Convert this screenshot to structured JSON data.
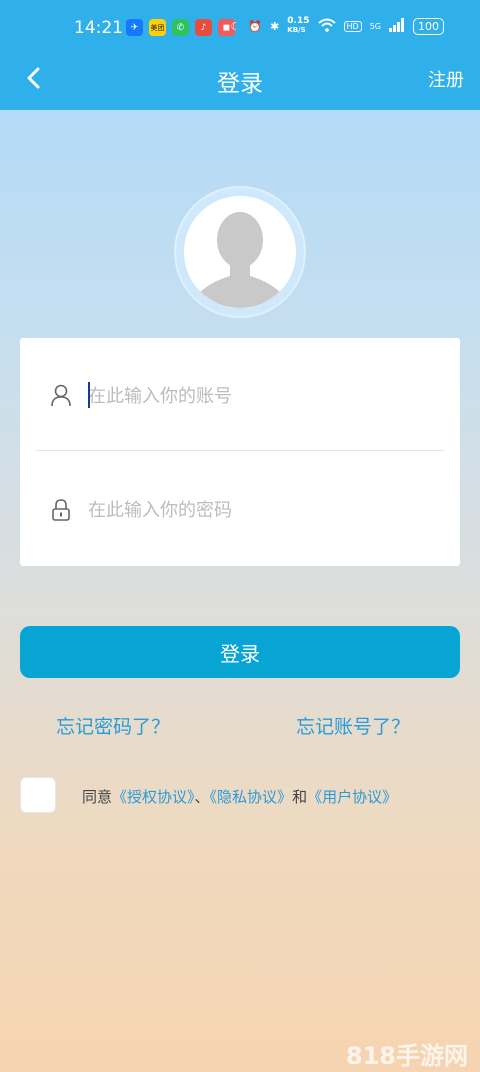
{
  "status": {
    "time": "14:21",
    "speed_value": "0.15",
    "speed_unit": "KB/S",
    "hd": "HD",
    "network": "5G",
    "battery": "100",
    "app_label": "美团"
  },
  "nav": {
    "title": "登录",
    "register": "注册"
  },
  "form": {
    "account_placeholder": "在此输入你的账号",
    "password_placeholder": "在此输入你的密码"
  },
  "login_button": "登录",
  "forgot_password": "忘记密码了？",
  "forgot_account": "忘记账号了？",
  "agreement": {
    "prefix": "同意",
    "auth": "《授权协议》",
    "sep": "、",
    "privacy": "《隐私协议》",
    "and": "和",
    "user": "《用户协议》"
  },
  "watermark": "818手游网",
  "colors": {
    "header": "#2fb0ea",
    "button": "#07a4d4",
    "link": "#2a9bd7"
  }
}
